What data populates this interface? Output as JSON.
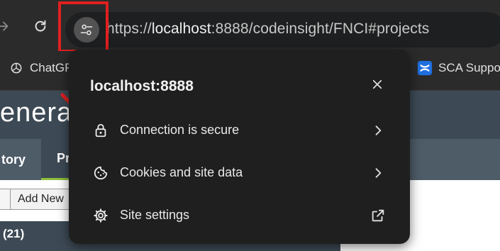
{
  "browser": {
    "url_prefix": "https://",
    "url_host": "localhost",
    "url_rest": ":8888/codeinsight/FNCI#projects",
    "bookmarks": [
      {
        "label": "ChatGP",
        "icon": "openai-icon"
      },
      {
        "label": "SCA Suppo",
        "icon": "confluence-icon"
      }
    ]
  },
  "page": {
    "logo_text": "enera",
    "tabs": [
      "tory",
      "Pr"
    ],
    "add_new_label": "Add New",
    "list_header": "(21)"
  },
  "popup": {
    "title": "localhost:8888",
    "items": [
      {
        "label": "Connection is secure",
        "icon": "lock-icon",
        "action": "chevron-right-icon"
      },
      {
        "label": "Cookies and site data",
        "icon": "cookie-icon",
        "action": "chevron-right-icon"
      },
      {
        "label": "Site settings",
        "icon": "gear-icon",
        "action": "open-in-new-icon"
      }
    ]
  },
  "colors": {
    "annotation": "#e02020",
    "page_header": "#3d4a55",
    "accent_green": "#8dbf3c"
  }
}
